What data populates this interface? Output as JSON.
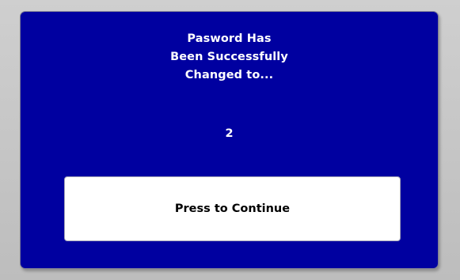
{
  "dialog": {
    "message_lines": [
      "Pasword Has",
      "Been Successfully",
      "Changed to..."
    ],
    "new_password": "2",
    "continue_label": "Press to Continue"
  },
  "colors": {
    "panel_background": "#0000a0",
    "text_on_panel": "#ffffff",
    "button_background": "#ffffff",
    "button_text": "#000000",
    "page_background": "#c3c3c3"
  }
}
